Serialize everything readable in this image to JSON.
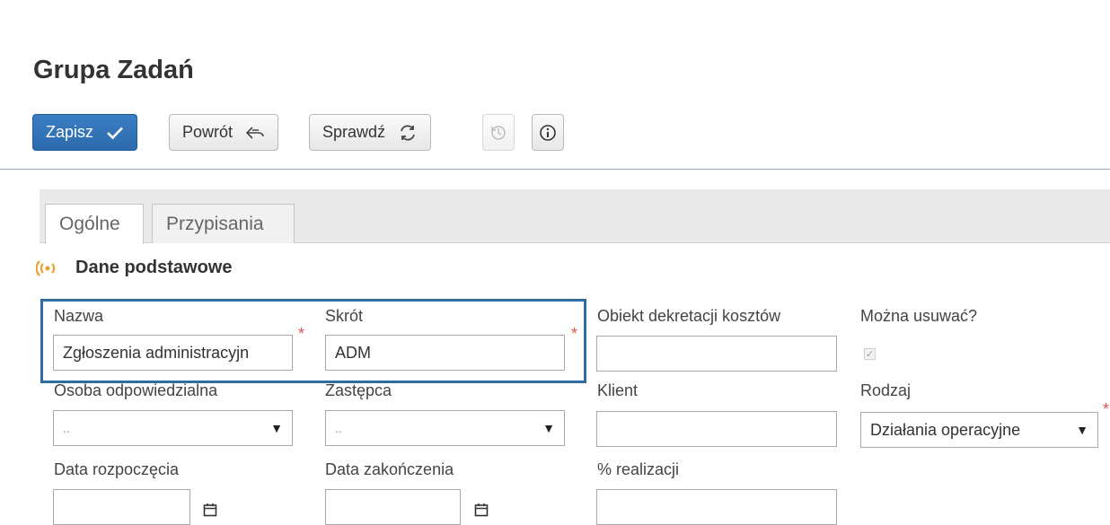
{
  "page": {
    "title": "Grupa Zadań"
  },
  "toolbar": {
    "save_label": "Zapisz",
    "back_label": "Powrót",
    "check_label": "Sprawdź"
  },
  "tabs": [
    {
      "label": "Ogólne",
      "active": true
    },
    {
      "label": "Przypisania",
      "active": false
    }
  ],
  "section": {
    "title": "Dane podstawowe"
  },
  "form": {
    "nazwa": {
      "label": "Nazwa",
      "value": "Zgłoszenia administracyjn"
    },
    "skrot": {
      "label": "Skrót",
      "value": "ADM"
    },
    "obiekt": {
      "label": "Obiekt dekretacji kosztów",
      "value": ""
    },
    "mozna_usuwac": {
      "label": "Można usuwać?",
      "checked": true
    },
    "osoba": {
      "label": "Osoba odpowiedzialna",
      "value": ".."
    },
    "zastepca": {
      "label": "Zastępca",
      "value": ".."
    },
    "klient": {
      "label": "Klient",
      "value": ""
    },
    "rodzaj": {
      "label": "Rodzaj",
      "value": "Działania operacyjne"
    },
    "data_rozpoczecia": {
      "label": "Data rozpoczęcia",
      "value": ""
    },
    "data_zakonczenia": {
      "label": "Data zakończenia",
      "value": ""
    },
    "realizacja": {
      "label": "% realizacji",
      "value": ""
    }
  },
  "colors": {
    "primary": "#2c6aad",
    "required": "#d9534f",
    "highlight": "#2e6da4",
    "section_icon": "#e8a02a"
  },
  "icons": [
    "check-icon",
    "undo-arrow-icon",
    "refresh-icon",
    "history-icon",
    "info-icon",
    "broadcast-icon",
    "calendar-icon",
    "dropdown-arrow-icon"
  ]
}
